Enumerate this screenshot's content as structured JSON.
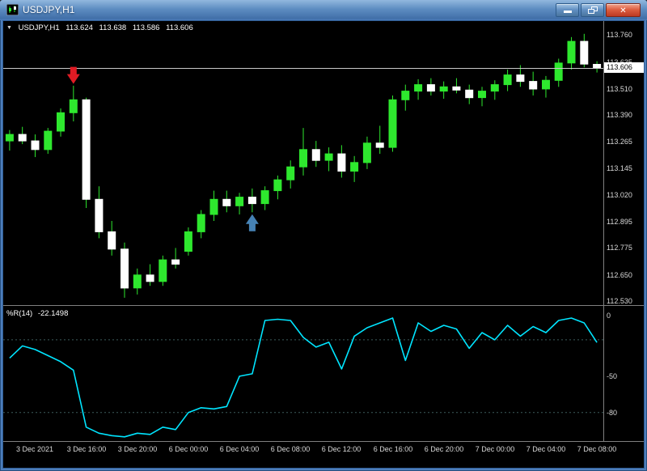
{
  "window": {
    "title": "USDJPY,H1",
    "minimize_label": "Minimize",
    "restore_label": "Restore Down",
    "close_label": "Close",
    "close_glyph": "✕"
  },
  "chart": {
    "collapse_glyph": "▼",
    "header": {
      "symbol": "USDJPY,H1",
      "open": "113.624",
      "high": "113.638",
      "low": "113.586",
      "close": "113.606"
    },
    "current_price": "113.606",
    "price_axis_labels": [
      "113.760",
      "113.635",
      "113.510",
      "113.390",
      "113.265",
      "113.145",
      "113.020",
      "112.895",
      "112.775",
      "112.650",
      "112.530"
    ]
  },
  "indicator": {
    "name": "%R(14)",
    "value": "-22.1498",
    "axis_labels": [
      "0",
      "-50",
      "-80"
    ]
  },
  "time_axis": {
    "ticks": [
      {
        "i": 2,
        "label": "3 Dec 2021"
      },
      {
        "i": 6,
        "label": "3 Dec 16:00"
      },
      {
        "i": 10,
        "label": "3 Dec 20:00"
      },
      {
        "i": 14,
        "label": "6 Dec 00:00"
      },
      {
        "i": 18,
        "label": "6 Dec 04:00"
      },
      {
        "i": 22,
        "label": "6 Dec 08:00"
      },
      {
        "i": 26,
        "label": "6 Dec 12:00"
      },
      {
        "i": 30,
        "label": "6 Dec 16:00"
      },
      {
        "i": 34,
        "label": "6 Dec 20:00"
      },
      {
        "i": 38,
        "label": "7 Dec 00:00"
      },
      {
        "i": 42,
        "label": "7 Dec 04:00"
      },
      {
        "i": 46,
        "label": "7 Dec 08:00"
      }
    ]
  },
  "colors": {
    "background": "#000000",
    "candle_bull": "#2ee82e",
    "candle_bear": "#ffffff",
    "wick": "#2ee82e",
    "indicator_line": "#00e5ff",
    "bid_line": "#c8c8c8",
    "sell_arrow": "#e01b24",
    "buy_arrow": "#4682b4",
    "axis_text": "#d9d9d9",
    "separator": "#7f7f7f"
  },
  "chart_data": [
    {
      "type": "candlestick",
      "title": "USDJPY H1",
      "ylim": [
        112.511,
        113.824
      ],
      "current_price": 113.606,
      "times": [
        "3 Dec 10:00",
        "3 Dec 11:00",
        "3 Dec 12:00",
        "3 Dec 13:00",
        "3 Dec 14:00",
        "3 Dec 15:00",
        "3 Dec 16:00",
        "3 Dec 17:00",
        "3 Dec 18:00",
        "3 Dec 19:00",
        "3 Dec 20:00",
        "3 Dec 21:00",
        "3 Dec 22:00",
        "3 Dec 23:00",
        "6 Dec 00:00",
        "6 Dec 01:00",
        "6 Dec 02:00",
        "6 Dec 03:00",
        "6 Dec 04:00",
        "6 Dec 05:00",
        "6 Dec 06:00",
        "6 Dec 07:00",
        "6 Dec 08:00",
        "6 Dec 09:00",
        "6 Dec 10:00",
        "6 Dec 11:00",
        "6 Dec 12:00",
        "6 Dec 13:00",
        "6 Dec 14:00",
        "6 Dec 15:00",
        "6 Dec 16:00",
        "6 Dec 17:00",
        "6 Dec 18:00",
        "6 Dec 19:00",
        "6 Dec 20:00",
        "6 Dec 21:00",
        "6 Dec 22:00",
        "6 Dec 23:00",
        "7 Dec 00:00",
        "7 Dec 01:00",
        "7 Dec 02:00",
        "7 Dec 03:00",
        "7 Dec 04:00",
        "7 Dec 05:00",
        "7 Dec 06:00",
        "7 Dec 07:00",
        "7 Dec 08:00"
      ],
      "ohlc": [
        [
          113.27,
          113.32,
          113.225,
          113.3
        ],
        [
          113.3,
          113.335,
          113.255,
          113.27
        ],
        [
          113.27,
          113.3,
          113.195,
          113.23
        ],
        [
          113.23,
          113.33,
          113.21,
          113.315
        ],
        [
          113.315,
          113.42,
          113.29,
          113.4
        ],
        [
          113.4,
          113.525,
          113.36,
          113.46
        ],
        [
          113.46,
          113.47,
          112.96,
          113.0
        ],
        [
          113.0,
          113.06,
          112.82,
          112.85
        ],
        [
          112.85,
          112.9,
          112.74,
          112.77
        ],
        [
          112.77,
          112.8,
          112.545,
          112.59
        ],
        [
          112.59,
          112.68,
          112.56,
          112.65
        ],
        [
          112.65,
          112.7,
          112.6,
          112.62
        ],
        [
          112.62,
          112.74,
          112.6,
          112.72
        ],
        [
          112.72,
          112.775,
          112.68,
          112.7
        ],
        [
          112.76,
          112.87,
          112.74,
          112.85
        ],
        [
          112.85,
          112.95,
          112.82,
          112.93
        ],
        [
          112.93,
          113.04,
          112.9,
          113.0
        ],
        [
          113.0,
          113.04,
          112.94,
          112.97
        ],
        [
          112.97,
          113.03,
          112.93,
          113.01
        ],
        [
          113.01,
          113.05,
          112.94,
          112.98
        ],
        [
          112.98,
          113.06,
          112.95,
          113.04
        ],
        [
          113.04,
          113.11,
          113.0,
          113.09
        ],
        [
          113.09,
          113.18,
          113.05,
          113.15
        ],
        [
          113.15,
          113.33,
          113.11,
          113.23
        ],
        [
          113.23,
          113.27,
          113.15,
          113.18
        ],
        [
          113.18,
          113.24,
          113.13,
          113.21
        ],
        [
          113.21,
          113.25,
          113.1,
          113.13
        ],
        [
          113.13,
          113.2,
          113.08,
          113.17
        ],
        [
          113.17,
          113.29,
          113.14,
          113.26
        ],
        [
          113.26,
          113.34,
          113.21,
          113.24
        ],
        [
          113.24,
          113.48,
          113.22,
          113.46
        ],
        [
          113.46,
          113.53,
          113.41,
          113.5
        ],
        [
          113.5,
          113.555,
          113.46,
          113.53
        ],
        [
          113.53,
          113.56,
          113.48,
          113.5
        ],
        [
          113.5,
          113.545,
          113.465,
          113.52
        ],
        [
          113.52,
          113.56,
          113.49,
          113.505
        ],
        [
          113.505,
          113.53,
          113.44,
          113.47
        ],
        [
          113.47,
          113.52,
          113.43,
          113.5
        ],
        [
          113.5,
          113.55,
          113.46,
          113.53
        ],
        [
          113.53,
          113.6,
          113.5,
          113.575
        ],
        [
          113.575,
          113.62,
          113.52,
          113.545
        ],
        [
          113.545,
          113.59,
          113.48,
          113.51
        ],
        [
          113.51,
          113.57,
          113.47,
          113.55
        ],
        [
          113.55,
          113.65,
          113.52,
          113.63
        ],
        [
          113.63,
          113.75,
          113.6,
          113.73
        ],
        [
          113.73,
          113.765,
          113.61,
          113.625
        ],
        [
          113.624,
          113.638,
          113.586,
          113.606
        ]
      ],
      "signals": [
        {
          "kind": "sell",
          "i": 5,
          "price": 113.575
        },
        {
          "kind": "buy",
          "i": 19,
          "price": 112.89
        }
      ]
    },
    {
      "type": "line",
      "name": "Williams %R(14)",
      "ylim": [
        -103.5,
        8
      ],
      "levels": [
        -20,
        -80
      ],
      "current_value": -22.1498,
      "values": [
        -35,
        -25,
        -28,
        -33,
        -38,
        -45,
        -92,
        -97,
        -99,
        -100,
        -97,
        -98,
        -92,
        -94,
        -80,
        -76,
        -77,
        -75,
        -50,
        -48,
        -4,
        -3,
        -4,
        -18,
        -26,
        -22,
        -44,
        -17,
        -10,
        -6,
        -2,
        -37,
        -6,
        -13,
        -8,
        -11,
        -27,
        -14,
        -20,
        -8,
        -17,
        -9,
        -14,
        -4,
        -2,
        -6,
        -22.1498
      ]
    }
  ]
}
